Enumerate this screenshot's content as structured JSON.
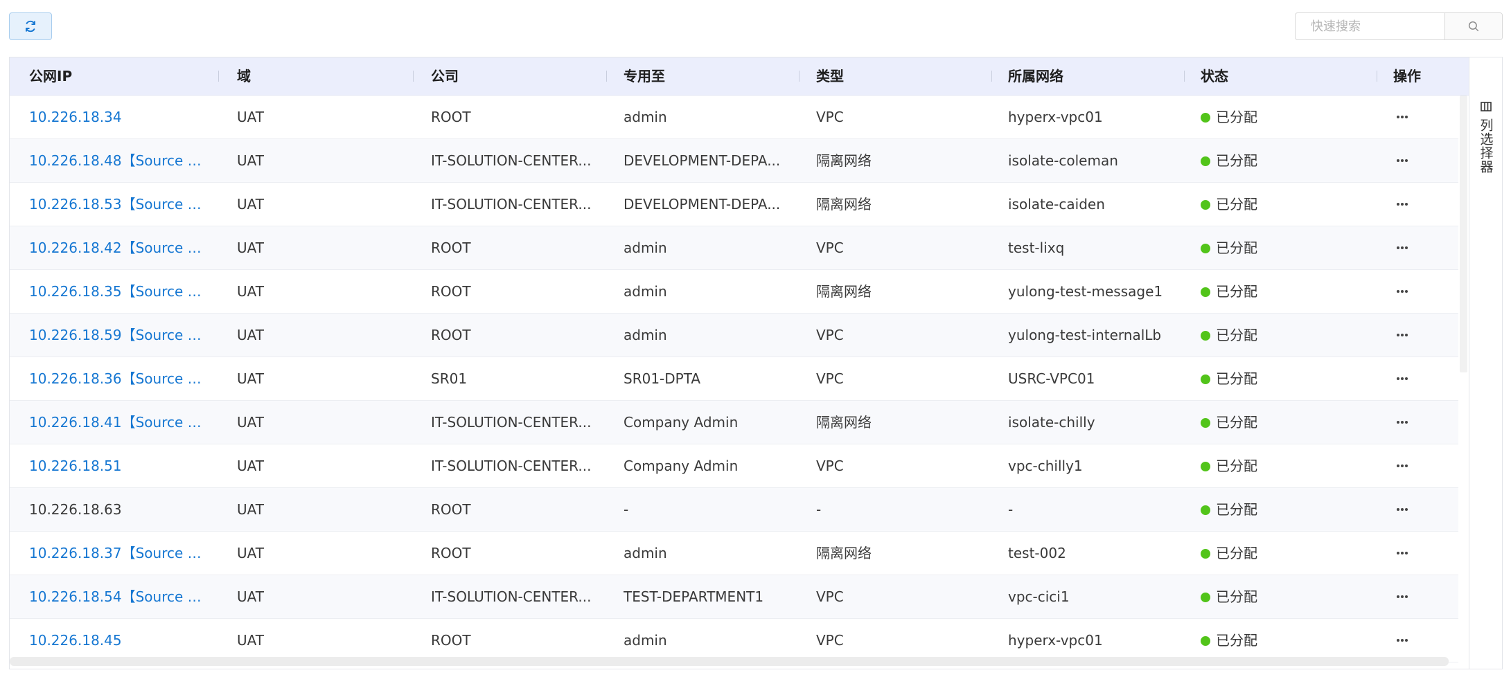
{
  "toolbar": {
    "refresh_icon": "refresh-icon"
  },
  "search": {
    "placeholder": "快速搜索",
    "value": "",
    "icon": "search-icon"
  },
  "columns": [
    "公网IP",
    "域",
    "公司",
    "专用至",
    "类型",
    "所属网络",
    "状态",
    "操作"
  ],
  "column_picker": {
    "label": "列选择器",
    "icon": "columns-icon"
  },
  "colors": {
    "link": "#1677d2",
    "status_allocated": "#52c41a",
    "header_bg": "#ebeefc",
    "accent_border": "#a8cdee"
  },
  "rows": [
    {
      "ip": "10.226.18.34",
      "ip_link": true,
      "domain": "UAT",
      "company": "ROOT",
      "dedicated_to": "admin",
      "type": "VPC",
      "network": "hyperx-vpc01",
      "status": "已分配"
    },
    {
      "ip": "10.226.18.48【Source N...",
      "ip_link": true,
      "domain": "UAT",
      "company": "IT-SOLUTION-CENTER...",
      "dedicated_to": "DEVELOPMENT-DEPA...",
      "type": "隔离网络",
      "network": "isolate-coleman",
      "status": "已分配"
    },
    {
      "ip": "10.226.18.53【Source N...",
      "ip_link": true,
      "domain": "UAT",
      "company": "IT-SOLUTION-CENTER...",
      "dedicated_to": "DEVELOPMENT-DEPA...",
      "type": "隔离网络",
      "network": "isolate-caiden",
      "status": "已分配"
    },
    {
      "ip": "10.226.18.42【Source N...",
      "ip_link": true,
      "domain": "UAT",
      "company": "ROOT",
      "dedicated_to": "admin",
      "type": "VPC",
      "network": "test-lixq",
      "status": "已分配"
    },
    {
      "ip": "10.226.18.35【Source N...",
      "ip_link": true,
      "domain": "UAT",
      "company": "ROOT",
      "dedicated_to": "admin",
      "type": "隔离网络",
      "network": "yulong-test-message1",
      "status": "已分配"
    },
    {
      "ip": "10.226.18.59【Source N...",
      "ip_link": true,
      "domain": "UAT",
      "company": "ROOT",
      "dedicated_to": "admin",
      "type": "VPC",
      "network": "yulong-test-internalLb",
      "status": "已分配"
    },
    {
      "ip": "10.226.18.36【Source N...",
      "ip_link": true,
      "domain": "UAT",
      "company": "SR01",
      "dedicated_to": "SR01-DPTA",
      "type": "VPC",
      "network": "USRC-VPC01",
      "status": "已分配"
    },
    {
      "ip": "10.226.18.41【Source N...",
      "ip_link": true,
      "domain": "UAT",
      "company": "IT-SOLUTION-CENTER...",
      "dedicated_to": "Company Admin",
      "type": "隔离网络",
      "network": "isolate-chilly",
      "status": "已分配"
    },
    {
      "ip": "10.226.18.51",
      "ip_link": true,
      "domain": "UAT",
      "company": "IT-SOLUTION-CENTER...",
      "dedicated_to": "Company Admin",
      "type": "VPC",
      "network": "vpc-chilly1",
      "status": "已分配"
    },
    {
      "ip": "10.226.18.63",
      "ip_link": false,
      "domain": "UAT",
      "company": "ROOT",
      "dedicated_to": "-",
      "type": "-",
      "network": "-",
      "status": "已分配"
    },
    {
      "ip": "10.226.18.37【Source N...",
      "ip_link": true,
      "domain": "UAT",
      "company": "ROOT",
      "dedicated_to": "admin",
      "type": "隔离网络",
      "network": "test-002",
      "status": "已分配"
    },
    {
      "ip": "10.226.18.54【Source N...",
      "ip_link": true,
      "domain": "UAT",
      "company": "IT-SOLUTION-CENTER...",
      "dedicated_to": "TEST-DEPARTMENT1",
      "type": "VPC",
      "network": "vpc-cici1",
      "status": "已分配"
    },
    {
      "ip": "10.226.18.45",
      "ip_link": true,
      "domain": "UAT",
      "company": "ROOT",
      "dedicated_to": "admin",
      "type": "VPC",
      "network": "hyperx-vpc01",
      "status": "已分配"
    }
  ]
}
